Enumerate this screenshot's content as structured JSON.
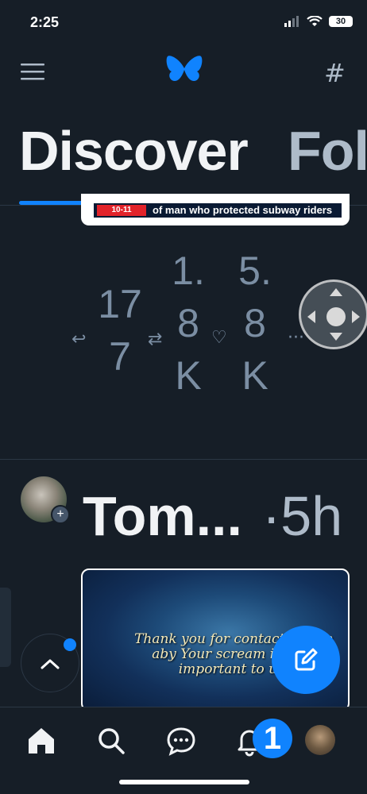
{
  "status_bar": {
    "time": "2:25",
    "battery": "30"
  },
  "header": {
    "menu_icon": "menu-icon",
    "logo": "butterfly-logo",
    "feeds_icon": "#"
  },
  "tabs": [
    {
      "label": "Discover",
      "active": true
    },
    {
      "label": "Fol",
      "active": false
    }
  ],
  "post1": {
    "image_date": "10-11",
    "image_headline": "of man who protected subway riders",
    "reply_count": "17\n7",
    "repost_count": "1.\n8\nK",
    "like_count": "5.\n8\nK",
    "icons": {
      "reply": "↩",
      "repost": "⇄",
      "like": "♡",
      "more": "···"
    }
  },
  "post2": {
    "author": "Tom...",
    "time": "·5h",
    "image_text": "Thank you for contacting the aby Your scream is very important to us."
  },
  "nav": {
    "items": [
      "home",
      "search",
      "chat",
      "notifications",
      "profile"
    ],
    "notification_badge": "1"
  },
  "colors": {
    "accent": "#1083fe",
    "background": "#161e27",
    "muted": "#7b8ea3"
  }
}
